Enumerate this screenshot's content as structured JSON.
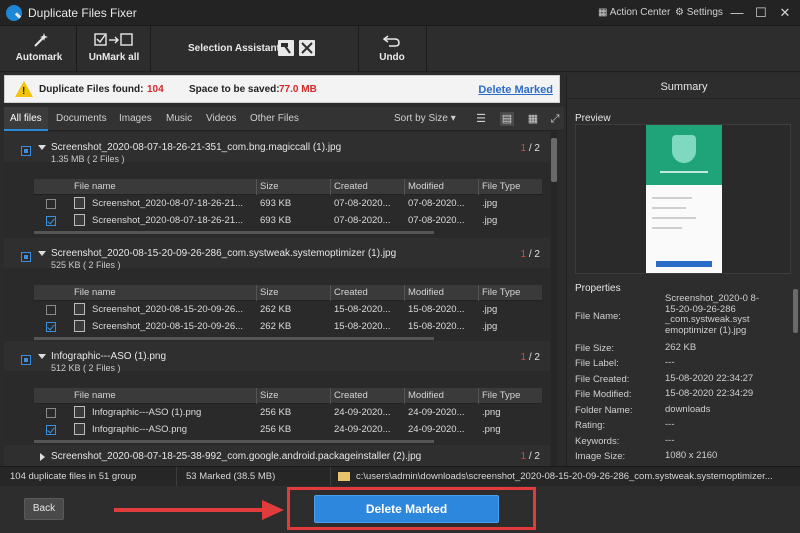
{
  "window": {
    "title": "Duplicate Files Fixer",
    "action_center": "Action Center",
    "settings": "Settings",
    "minimize": "—",
    "maximize": "☐",
    "close": "✕"
  },
  "toolbar": {
    "automark": "Automark",
    "unmark_all": "UnMark all",
    "selection_assistant": "Selection Assistant",
    "undo": "Undo"
  },
  "banner": {
    "found_label": "Duplicate Files found:",
    "found_value": "104",
    "space_label": "Space to be saved:",
    "space_value": "77.0 MB",
    "delete_link": "Delete Marked"
  },
  "tabs": [
    "All files",
    "Documents",
    "Images",
    "Music",
    "Videos",
    "Other Files"
  ],
  "sort_label": "Sort by Size",
  "columns": [
    "File name",
    "Size",
    "Created",
    "Modified",
    "File Type"
  ],
  "groups": [
    {
      "name": "Screenshot_2020-08-07-18-26-21-351_com.bng.magiccall (1).jpg",
      "size": "1.35 MB  ( 2 Files )",
      "marked": "1",
      "total": "/ 2",
      "rows": [
        {
          "name": "Screenshot_2020-08-07-18-26-21...",
          "size": "693 KB",
          "created": "07-08-2020...",
          "modified": "07-08-2020...",
          "type": ".jpg",
          "checked": false
        },
        {
          "name": "Screenshot_2020-08-07-18-26-21...",
          "size": "693 KB",
          "created": "07-08-2020...",
          "modified": "07-08-2020...",
          "type": ".jpg",
          "checked": true
        }
      ]
    },
    {
      "name": "Screenshot_2020-08-15-20-09-26-286_com.systweak.systemoptimizer (1).jpg",
      "size": "525 KB  ( 2 Files )",
      "marked": "1",
      "total": "/ 2",
      "rows": [
        {
          "name": "Screenshot_2020-08-15-20-09-26...",
          "size": "262 KB",
          "created": "15-08-2020...",
          "modified": "15-08-2020...",
          "type": ".jpg",
          "checked": false
        },
        {
          "name": "Screenshot_2020-08-15-20-09-26...",
          "size": "262 KB",
          "created": "15-08-2020...",
          "modified": "15-08-2020...",
          "type": ".jpg",
          "checked": true
        }
      ]
    },
    {
      "name": "Infographic---ASO (1).png",
      "size": "512 KB  ( 2 Files )",
      "marked": "1",
      "total": "/ 2",
      "rows": [
        {
          "name": "Infographic---ASO (1).png",
          "size": "256 KB",
          "created": "24-09-2020...",
          "modified": "24-09-2020...",
          "type": ".png",
          "checked": false
        },
        {
          "name": "Infographic---ASO.png",
          "size": "256 KB",
          "created": "24-09-2020...",
          "modified": "24-09-2020...",
          "type": ".png",
          "checked": true
        }
      ]
    },
    {
      "name": "Screenshot_2020-08-07-18-25-38-992_com.google.android.packageinstaller (2).jpg",
      "marked": "1",
      "total": "/ 2"
    }
  ],
  "summary": {
    "title": "Summary",
    "preview_label": "Preview",
    "properties_label": "Properties",
    "props": [
      {
        "key": "File Name:",
        "value": "Screenshot_2020-0 8-15-20-09-26-286 _com.systweak.syst emoptimizer (1).jpg"
      },
      {
        "key": "File Size:",
        "value": "262 KB"
      },
      {
        "key": "File Label:",
        "value": "---"
      },
      {
        "key": "File Created:",
        "value": "15-08-2020 22:34:27"
      },
      {
        "key": "File Modified:",
        "value": "15-08-2020 22:34:29"
      },
      {
        "key": "Folder Name:",
        "value": "downloads"
      },
      {
        "key": "Rating:",
        "value": "---"
      },
      {
        "key": "Keywords:",
        "value": "---"
      },
      {
        "key": "Image Size:",
        "value": "1080 x 2160"
      }
    ]
  },
  "status": {
    "groups": "104 duplicate files in 51 group",
    "marked": "53 Marked (38.5 MB)",
    "path": "c:\\users\\admin\\downloads\\screenshot_2020-08-15-20-09-26-286_com.systweak.systemoptimizer..."
  },
  "bottom": {
    "back": "Back",
    "delete_marked": "Delete Marked"
  },
  "colors": {
    "accent": "#2d87dd",
    "highlight": "#e23b3b",
    "warning": "#f1c40f"
  }
}
